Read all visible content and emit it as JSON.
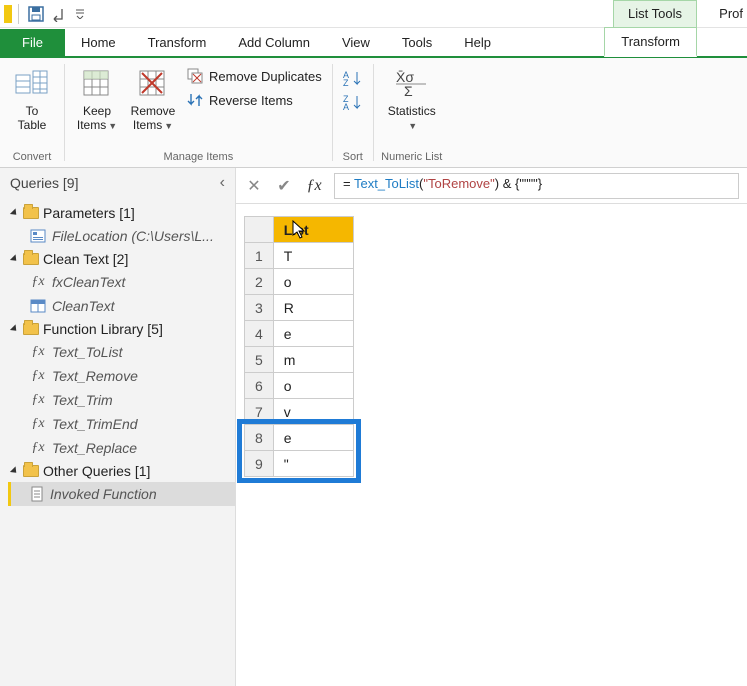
{
  "qat": {
    "tools_tab": "List Tools",
    "prob": "Prof"
  },
  "tabs": {
    "file": "File",
    "home": "Home",
    "transform": "Transform",
    "add_column": "Add Column",
    "view": "View",
    "tools": "Tools",
    "help": "Help",
    "active": "Transform"
  },
  "ribbon": {
    "to_table": "To\nTable",
    "convert_group": "Convert",
    "keep_items": "Keep\nItems",
    "remove_items": "Remove\nItems",
    "remove_duplicates": "Remove Duplicates",
    "reverse_items": "Reverse Items",
    "manage_group": "Manage Items",
    "sort_group": "Sort",
    "statistics": "Statistics",
    "numeric_group": "Numeric List"
  },
  "queries": {
    "title": "Queries [9]",
    "groups": [
      {
        "label": "Parameters [1]",
        "items": [
          {
            "type": "param",
            "label": "FileLocation (C:\\Users\\L..."
          }
        ]
      },
      {
        "label": "Clean Text [2]",
        "items": [
          {
            "type": "fx",
            "label": "fxCleanText"
          },
          {
            "type": "table",
            "label": "CleanText"
          }
        ]
      },
      {
        "label": "Function Library [5]",
        "items": [
          {
            "type": "fx",
            "label": "Text_ToList"
          },
          {
            "type": "fx",
            "label": "Text_Remove"
          },
          {
            "type": "fx",
            "label": "Text_Trim"
          },
          {
            "type": "fx",
            "label": "Text_TrimEnd"
          },
          {
            "type": "fx",
            "label": "Text_Replace"
          }
        ]
      },
      {
        "label": "Other Queries [1]",
        "items": [
          {
            "type": "list",
            "label": "Invoked Function",
            "selected": true
          }
        ]
      }
    ]
  },
  "formula": {
    "prefix": "= ",
    "fn": "Text_ToList",
    "open": "(",
    "arg": "\"ToRemove\"",
    "close": ")",
    "ampersand": " & ",
    "tail": "{\"\"\"\"}"
  },
  "list": {
    "header": "List",
    "rows": [
      "T",
      "o",
      "R",
      "e",
      "m",
      "o",
      "v",
      "e",
      "\""
    ],
    "highlight_rows": [
      8,
      9
    ]
  }
}
